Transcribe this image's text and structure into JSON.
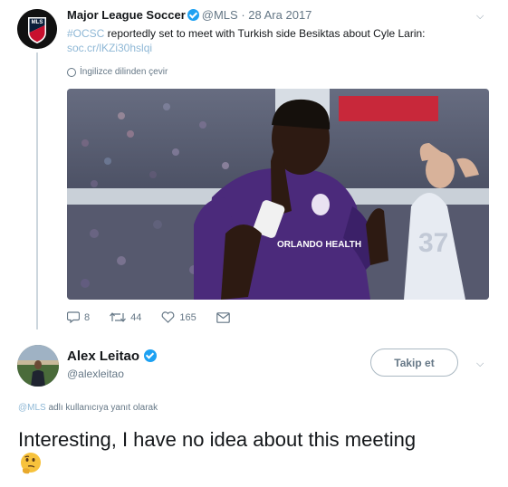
{
  "parent_tweet": {
    "author_name": "Major League Soccer",
    "author_handle": "@MLS",
    "date": "· 28 Ara 2017",
    "avatar_text": "MLS",
    "hashtag": "#OCSC",
    "text": " reportedly set to meet with Turkish side Besiktas about Cyle Larin:",
    "link": "soc.cr/lKZi30hslqi",
    "translate_label": "İngilizce dilinden çevir",
    "photo": {
      "shirt_text": "ORLANDO HEALTH",
      "player_number": "37"
    },
    "actions": {
      "reply_count": "8",
      "retweet_count": "44",
      "like_count": "165"
    }
  },
  "reply_tweet": {
    "author_name": "Alex Leitao",
    "author_handle": "@alexleitao",
    "follow_label": "Takip et",
    "reply_to_mention": "@MLS",
    "reply_to_suffix": " adlı kullanıcıya yanıt olarak",
    "text": "Interesting, I have no idea about this meeting",
    "emoji": "thinking-face"
  },
  "colors": {
    "link": "#8fb8d6",
    "verified": "#1da1f2",
    "muted": "#657786",
    "jersey": "#4b2a7b"
  }
}
